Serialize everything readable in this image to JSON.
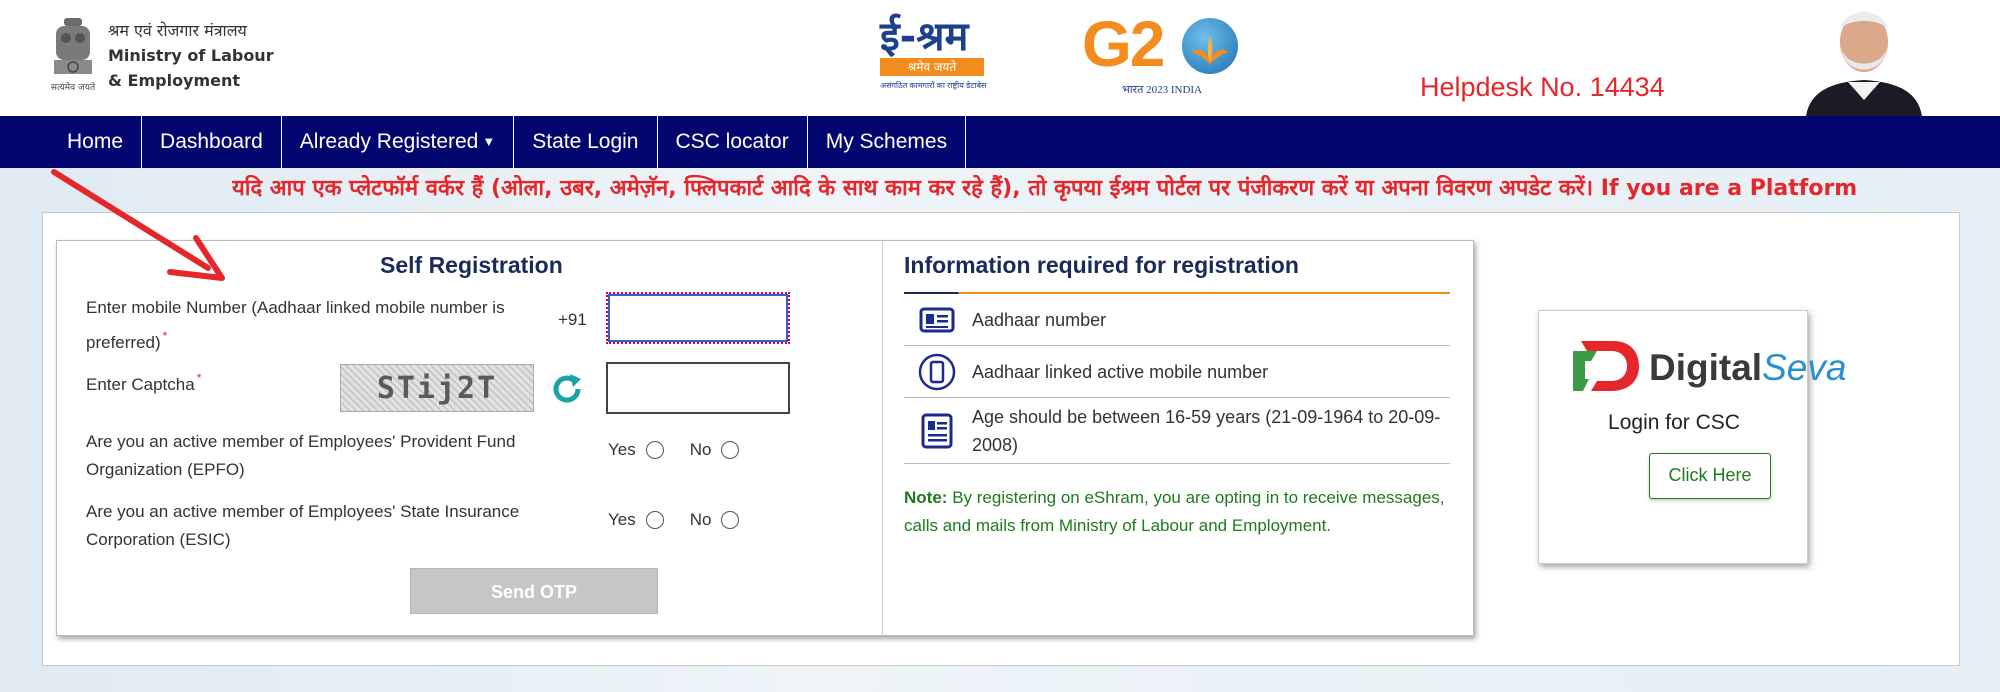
{
  "header": {
    "ministry_hindi": "श्रम एवं रोजगार मंत्रालय",
    "ministry_line1": "Ministry of Labour",
    "ministry_line2": "& Employment",
    "emblem_motto": "सत्यमेव जयते",
    "eshram_logo_text": "ई-श्रम",
    "eshram_logo_bar": "श्रमेव जयते",
    "eshram_logo_sub": "असंगठित कामगारों का राष्ट्रीय डेटाबेस",
    "g20_text": "G2",
    "g20_sub": "भारत 2023 INDIA",
    "helpdesk": "Helpdesk No. 14434"
  },
  "nav": {
    "items": [
      {
        "label": "Home"
      },
      {
        "label": "Dashboard"
      },
      {
        "label": "Already Registered"
      },
      {
        "label": "State Login"
      },
      {
        "label": "CSC locator"
      },
      {
        "label": "My Schemes"
      }
    ]
  },
  "marquee": "यदि आप एक प्लेटफॉर्म वर्कर हैं (ओला, उबर, अमेज़ॅन, फ्लिपकार्ट आदि के साथ काम कर रहे हैं), तो कृपया ईश्रम पोर्टल पर पंजीकरण करें या अपना विवरण अपडेट करें। If you are a Platform",
  "self_registration": {
    "title": "Self Registration",
    "mobile_label_1": "Enter mobile Number (Aadhaar linked mobile number is",
    "mobile_label_2": "preferred)",
    "required_mark": "*",
    "prefix": "+91",
    "mobile_value": "",
    "captcha_label": "Enter Captcha",
    "captcha_text": "STij2T",
    "captcha_value": "",
    "epfo_label_1": "Are you an active member of Employees' Provident Fund",
    "epfo_label_2": "Organization (EPFO)",
    "esic_label_1": "Are you an active member of Employees' State Insurance",
    "esic_label_2": "Corporation (ESIC)",
    "yes": "Yes",
    "no": "No",
    "send_otp": "Send OTP"
  },
  "info": {
    "title": "Information required for registration",
    "items": [
      {
        "text": "Aadhaar number",
        "icon": "id-card-icon"
      },
      {
        "text": "Aadhaar linked active mobile number",
        "icon": "mobile-phone-icon"
      },
      {
        "text_1": "Age should be between 16-59 years (21-09-1964 to 20-09-",
        "text_2": "2008)",
        "icon": "id-badge-icon"
      }
    ],
    "note_label": "Note:",
    "note_text_1": "By registering on eShram, you are opting in to receive messages,",
    "note_text_2": "calls and mails from Ministry of Labour and Employment."
  },
  "csc": {
    "logo_digital": "Digital",
    "logo_seva": "Seva",
    "login_text": "Login for CSC",
    "button": "Click Here"
  },
  "colors": {
    "nav_bg": "#03066e",
    "accent_red": "#e5262a",
    "accent_orange": "#f28c1e",
    "note_green": "#1f7a1f",
    "heading_navy": "#1a2b5a"
  }
}
